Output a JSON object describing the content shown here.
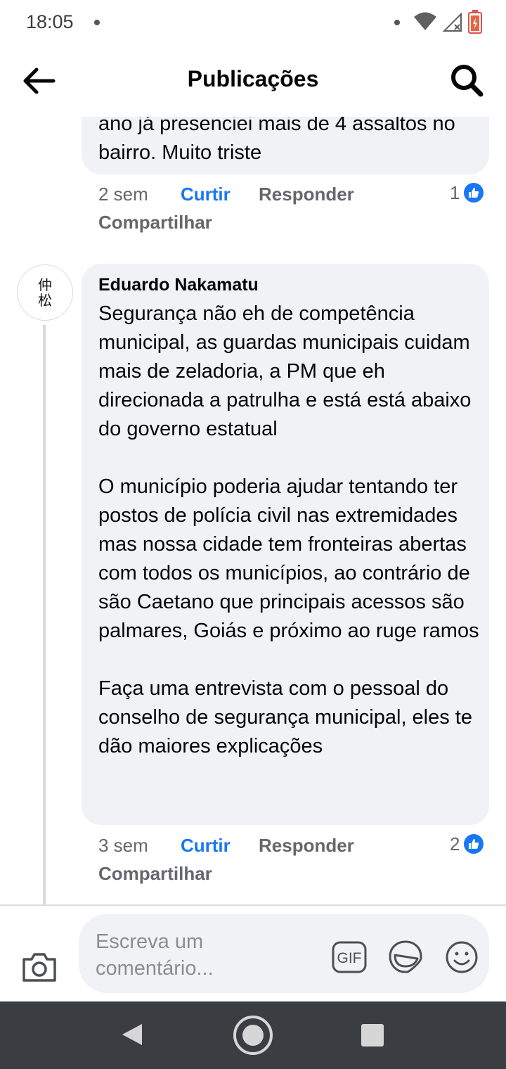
{
  "status_bar": {
    "time": "18:05"
  },
  "header": {
    "title": "Publicações",
    "back_icon": "arrow-left-icon",
    "search_icon": "search-icon"
  },
  "previous_comment": {
    "text_tail": "ano já presenciei mais de 4 assaltos no bairro. Muito triste",
    "time": "2 sem",
    "like_label": "Curtir",
    "reply_label": "Responder",
    "share_label": "Compartilhar",
    "reaction_count": "1"
  },
  "comment": {
    "author": "Eduardo Nakamatu",
    "avatar_text": "仲松",
    "paragraphs": [
      "Segurança não eh de competência municipal, as guardas municipais cuidam mais de zeladoria, a PM que eh direcionada a patrulha e está está abaixo do governo estatual",
      "O município poderia ajudar tentando ter postos de polícia civil nas extremidades mas nossa cidade tem fronteiras abertas com todos os municípios, ao contrário de são Caetano que  principais acessos são palmares, Goiás e próximo ao ruge ramos",
      "Faça uma entrevista com o pessoal do conselho de segurança municipal, eles te dão maiores explicações"
    ],
    "time": "3 sem",
    "like_label": "Curtir",
    "reply_label": "Responder",
    "share_label": "Compartilhar",
    "reaction_count": "2"
  },
  "composer": {
    "placeholder": "Escreva um comentário...",
    "gif_label": "GIF"
  },
  "colors": {
    "accent": "#1877f2",
    "bubble": "#f0f2f5",
    "secondary_text": "#65676b",
    "nav_bar": "#3a3d42"
  }
}
